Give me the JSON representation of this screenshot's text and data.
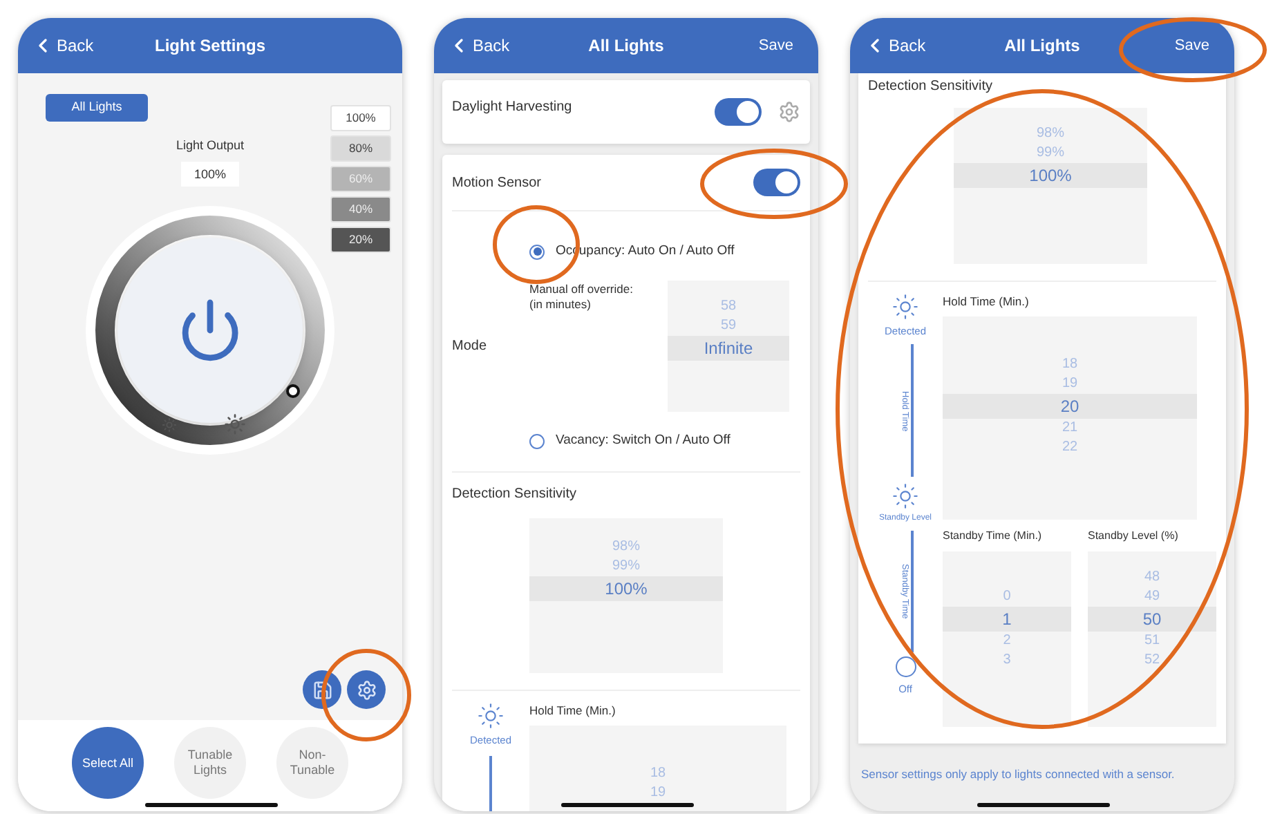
{
  "light_settings": {
    "header": {
      "back": "Back",
      "title": "Light Settings"
    },
    "group_button": "All Lights",
    "light_output": {
      "label": "Light Output",
      "value": "100%"
    },
    "presets": [
      {
        "label": "100%",
        "color": "#ffffff"
      },
      {
        "label": "80%",
        "color": "#d9d9d9"
      },
      {
        "label": "60%",
        "color": "#b4b4b4"
      },
      {
        "label": "40%",
        "color": "#8a8a8a"
      },
      {
        "label": "20%",
        "color": "#555555"
      }
    ],
    "groups": [
      {
        "label": "Select All",
        "selected": true
      },
      {
        "label": "Tunable Lights",
        "selected": false
      },
      {
        "label": "Non-Tunable",
        "selected": false
      }
    ]
  },
  "sensor_settings": {
    "header": {
      "back": "Back",
      "title": "All Lights",
      "action": "Save"
    },
    "daylight_harvesting": {
      "label": "Daylight Harvesting",
      "on": true
    },
    "motion_sensor": {
      "label": "Motion Sensor",
      "on": true
    },
    "mode": {
      "label": "Mode",
      "options": [
        {
          "label": "Occupancy: Auto On / Auto Off",
          "selected": true
        },
        {
          "label": "Vacancy: Switch On / Auto Off",
          "selected": false
        }
      ],
      "override_label": "Manual off override:",
      "override_note": "(in minutes)",
      "override_picker": [
        {
          "label": "58",
          "selected": false
        },
        {
          "label": "59",
          "selected": false
        },
        {
          "label": "Infinite",
          "selected": true
        }
      ]
    },
    "detection_sensitivity": {
      "label": "Detection Sensitivity",
      "picker": [
        {
          "label": "98%",
          "selected": false
        },
        {
          "label": "99%",
          "selected": false
        },
        {
          "label": "100%",
          "selected": true
        }
      ]
    },
    "hold_time": {
      "state_label": "Detected",
      "label": "Hold Time (Min.)",
      "picker": [
        {
          "label": "18",
          "selected": false
        },
        {
          "label": "19",
          "selected": false
        }
      ]
    }
  },
  "sensor_settings_scrolled": {
    "header": {
      "back": "Back",
      "title": "All Lights",
      "action": "Save"
    },
    "detection_sensitivity": {
      "label": "Detection Sensitivity",
      "picker": [
        {
          "label": "98%",
          "selected": false
        },
        {
          "label": "99%",
          "selected": false
        },
        {
          "label": "100%",
          "selected": true
        }
      ]
    },
    "timeline": {
      "detected": "Detected",
      "hold": "Hold Time",
      "standby": "Standby Level",
      "standby_time": "Standby Time",
      "off": "Off"
    },
    "hold_time": {
      "label": "Hold Time (Min.)",
      "picker": [
        {
          "label": "18",
          "selected": false
        },
        {
          "label": "19",
          "selected": false
        },
        {
          "label": "20",
          "selected": true
        },
        {
          "label": "21",
          "selected": false
        },
        {
          "label": "22",
          "selected": false
        }
      ]
    },
    "standby_time": {
      "label": "Standby Time (Min.)",
      "picker": [
        {
          "label": "0",
          "selected": false
        },
        {
          "label": "1",
          "selected": true
        },
        {
          "label": "2",
          "selected": false
        },
        {
          "label": "3",
          "selected": false
        }
      ]
    },
    "standby_level": {
      "label": "Standby Level (%)",
      "picker": [
        {
          "label": "48",
          "selected": false
        },
        {
          "label": "49",
          "selected": false
        },
        {
          "label": "50",
          "selected": true
        },
        {
          "label": "51",
          "selected": false
        },
        {
          "label": "52",
          "selected": false
        }
      ]
    },
    "footnote": "Sensor settings only apply to lights connected with a sensor."
  }
}
